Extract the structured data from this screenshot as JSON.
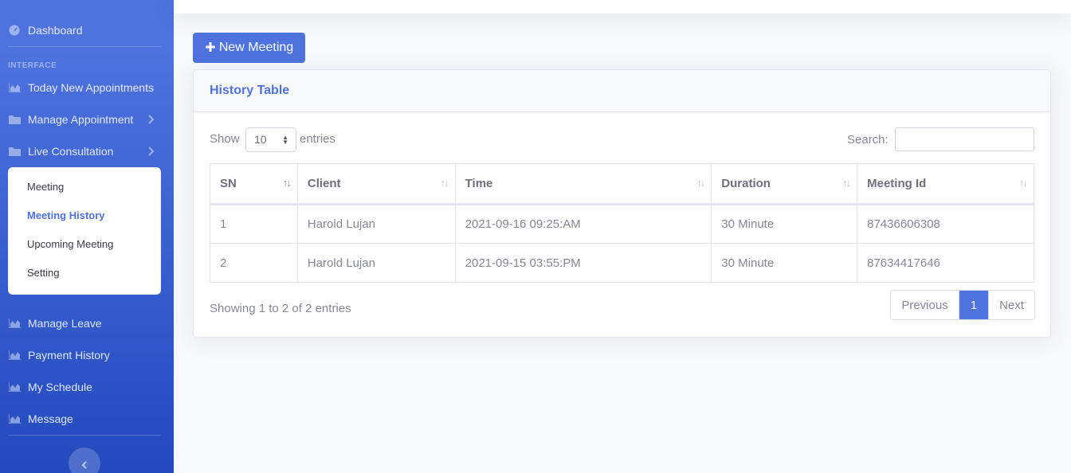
{
  "sidebar": {
    "dashboard": "Dashboard",
    "heading": "INTERFACE",
    "items": [
      {
        "label": "Today New Appointments",
        "icon": "chart-area-icon"
      },
      {
        "label": "Manage Appointment",
        "icon": "folder-icon"
      },
      {
        "label": "Live Consultation",
        "icon": "folder-icon"
      },
      {
        "label": "Manage Leave",
        "icon": "chart-area-icon"
      },
      {
        "label": "Payment History",
        "icon": "chart-area-icon"
      },
      {
        "label": "My Schedule",
        "icon": "chart-area-icon"
      },
      {
        "label": "Message",
        "icon": "chart-area-icon"
      }
    ],
    "submenu": [
      "Meeting",
      "Meeting History",
      "Upcoming Meeting",
      "Setting"
    ],
    "active_submenu": "Meeting History"
  },
  "new_meeting_label": "New Meeting",
  "card": {
    "title": "History Table",
    "show_label": "Show",
    "entries_value": "10",
    "entries_label": "entries",
    "search_label": "Search:",
    "search_value": ""
  },
  "table": {
    "columns": [
      "SN",
      "Client",
      "Time",
      "Duration",
      "Meeting Id"
    ],
    "rows": [
      [
        "1",
        "Harold Lujan",
        "2021-09-16 09:25:AM",
        "30 Minute",
        "87436606308"
      ],
      [
        "2",
        "Harold Lujan",
        "2021-09-15 03:55:PM",
        "30 Minute",
        "87634417646"
      ]
    ]
  },
  "footer": {
    "info": "Showing 1 to 2 of 2 entries",
    "previous": "Previous",
    "current_page": "1",
    "next": "Next"
  },
  "colors": {
    "primary": "#4e73df",
    "sidebar_bottom": "#224abe"
  }
}
